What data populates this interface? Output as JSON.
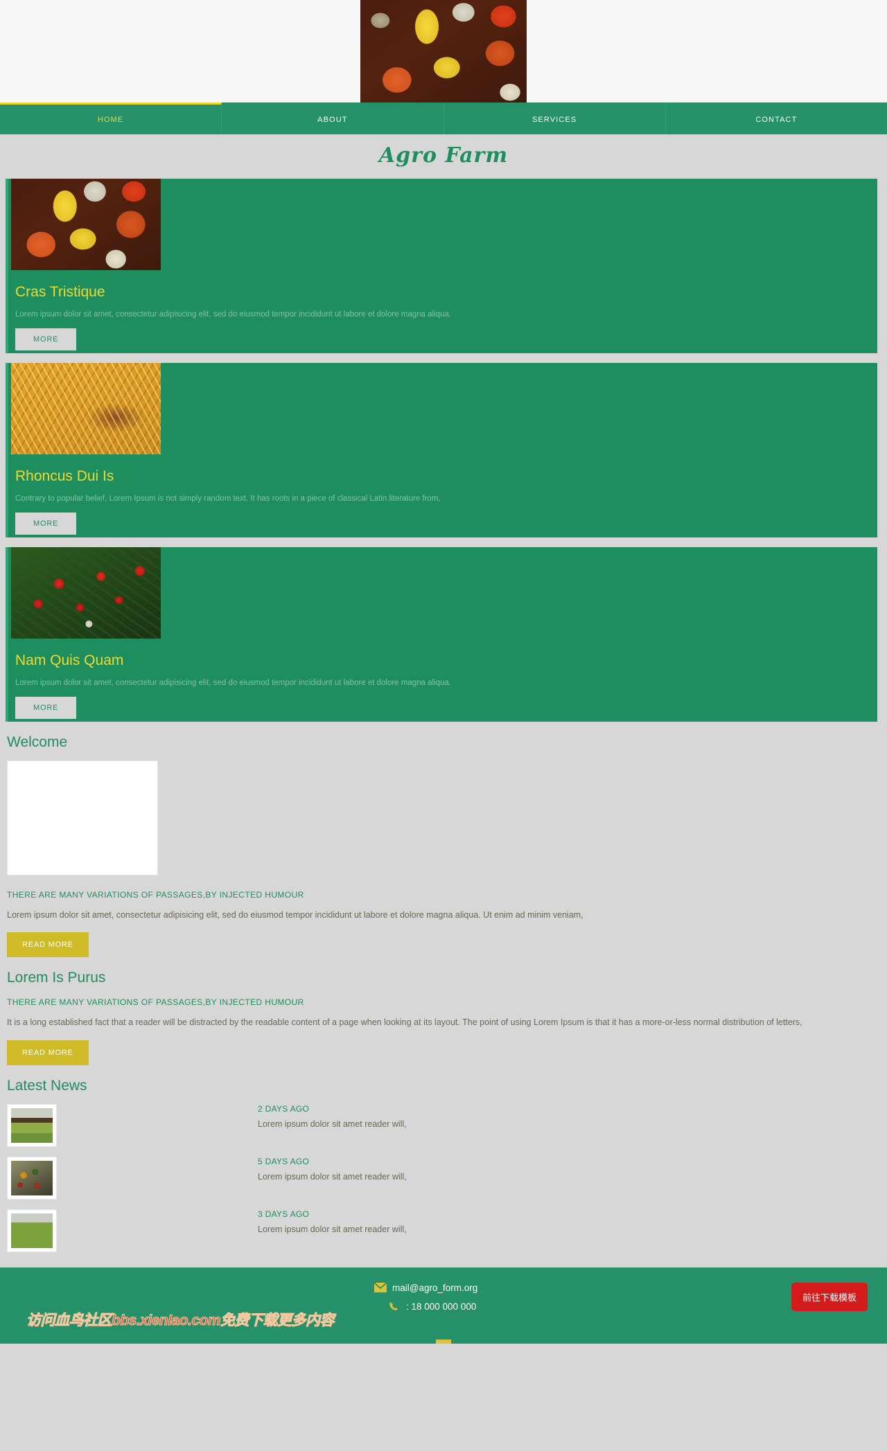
{
  "site": {
    "logo_text": "Agro Farm",
    "banner_image_alt": "pumpkins-and-squash-photo"
  },
  "nav": {
    "items": [
      {
        "label": "HOME",
        "active": true
      },
      {
        "label": "ABOUT",
        "active": false
      },
      {
        "label": "SERVICES",
        "active": false
      },
      {
        "label": "CONTACT",
        "active": false
      }
    ]
  },
  "cards": [
    {
      "title": "Cras Tristique",
      "desc": "Lorem ipsum dolor sit amet, consectetur adipisicing elit, sed do eiusmod tempor incididunt ut labore et dolore magna aliqua.",
      "button": "MORE",
      "image_alt": "pumpkins-photo"
    },
    {
      "title": "Rhoncus Dui Is",
      "desc": "Contrary to popular belief, Lorem Ipsum is not simply random text. It has roots in a piece of classical Latin literature from,",
      "button": "MORE",
      "image_alt": "wheat-photo"
    },
    {
      "title": "Nam Quis Quam",
      "desc": "Lorem ipsum dolor sit amet, consectetur adipisicing elit, sed do eiusmod tempor incididunt ut labore et dolore magna aliqua.",
      "button": "MORE",
      "image_alt": "tomatoes-photo"
    }
  ],
  "welcome": {
    "title": "Welcome",
    "image_alt": "hands-holding-potatoes-photo",
    "subhead": "THERE ARE MANY VARIATIONS OF PASSAGES,BY INJECTED HUMOUR",
    "body": "Lorem ipsum dolor sit amet, consectetur adipisicing elit, sed do eiusmod tempor incididunt ut labore et dolore magna aliqua. Ut enim ad minim veniam,",
    "button": "READ MORE"
  },
  "purus": {
    "title": "Lorem Is Purus",
    "subhead": "THERE ARE MANY VARIATIONS OF PASSAGES,BY INJECTED HUMOUR",
    "body": "It is a long established fact that a reader will be distracted by the readable content of a page when looking at its layout. The point of using Lorem Ipsum is that it has a more-or-less normal distribution of letters,",
    "button": "READ MORE"
  },
  "news": {
    "title": "Latest News",
    "items": [
      {
        "date": "2 DAYS AGO",
        "text": "Lorem ipsum dolor sit amet reader will,",
        "image_alt": "field-harvest-photo"
      },
      {
        "date": "5 DAYS AGO",
        "text": "Lorem ipsum dolor sit amet reader will,",
        "image_alt": "vegetables-photo"
      },
      {
        "date": "3 DAYS AGO",
        "text": "Lorem ipsum dolor sit amet reader will,",
        "image_alt": "tractor-photo"
      }
    ]
  },
  "footer": {
    "email": "mail@agro_form.org",
    "phone": ": 18 000 000 000",
    "watermark": "访问血鸟社区bbs.xienIao.com免费下载更多内容",
    "download_button": "前往下载模板"
  },
  "colors": {
    "green": "#1e8e5e",
    "nav_green": "#269068",
    "yellow": "#f0d92e",
    "gold_button": "#cfbb28",
    "page_bg": "#d7d7d7",
    "red_button": "#d31b1b"
  }
}
